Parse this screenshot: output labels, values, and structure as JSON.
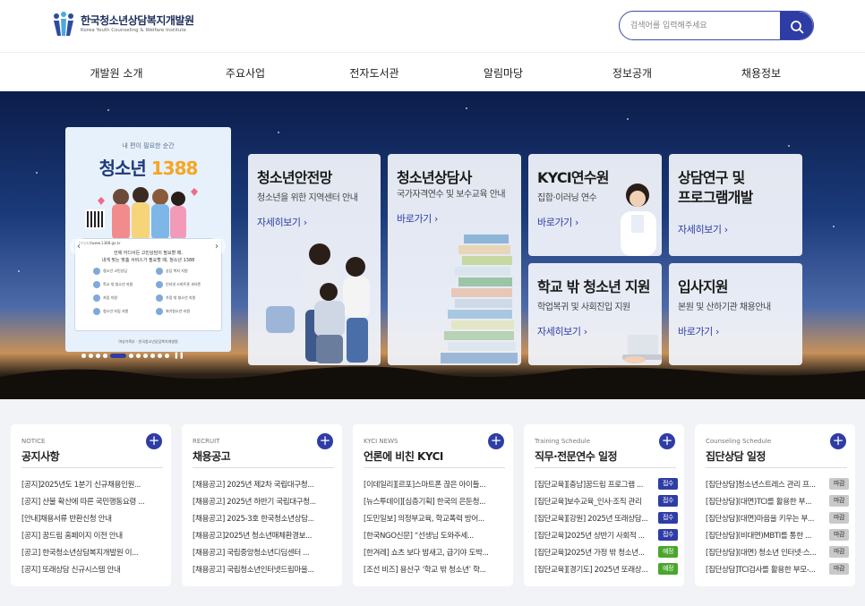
{
  "logo": {
    "name": "한국청소년상담복지개발원",
    "sub": "Korea Youth Counseling & Welfare Institute"
  },
  "search": {
    "placeholder": "검색어를 입력해주세요"
  },
  "nav": [
    "개발원 소개",
    "주요사업",
    "전자도서관",
    "알림마당",
    "정보공개",
    "채용정보"
  ],
  "poster": {
    "top": "내 편이 필요한 순간",
    "title": "청소년",
    "num": "1388",
    "url": "https://www.1388.go.kr",
    "head1": "언제 어디서든 고민상담이 필요할 때,",
    "head2": "내게 맞는 맞춤 서비스가 필요할 때, 청소년 1388",
    "grid": [
      "청소년 고민상담",
      "상담 복지 지원",
      "학교 밖 청소년 지원",
      "인터넷 스마트폰 과의존",
      "자립 지원",
      "가정 밖 청소년 지원",
      "청소년 자립 지원",
      "위기청소년 지원"
    ],
    "foot": "여성가족부 · 한국청소년상담복지개발원"
  },
  "cards": [
    {
      "title": "청소년안전망",
      "sub": "청소년을 위한 지역센터 안내",
      "link": "자세히보기"
    },
    {
      "title": "청소년상담사",
      "sub": "국가자격연수 및 보수교육 안내",
      "link": "바로가기"
    },
    {
      "title": "KYCI연수원",
      "sub": "집합·이러닝 연수",
      "link": "바로가기"
    },
    {
      "title1": "상담연구 및",
      "title2": "프로그램개발",
      "link": "자세히보기"
    },
    {
      "title": "학교 밖 청소년 지원",
      "sub": "학업복귀 및 사회진입 지원",
      "link": "자세히보기"
    },
    {
      "title": "입사지원",
      "sub": "본원 및 산하기관 채용안내",
      "link": "바로가기"
    }
  ],
  "panels": [
    {
      "cat": "NOTICE",
      "title": "공지사항",
      "items": [
        {
          "t": "[공지]2025년도 1분기 신규채용인원..."
        },
        {
          "t": "[공지] 산불 확산에 따른 국민행동요령 ..."
        },
        {
          "t": "[안내]채용서류 반환신청 안내"
        },
        {
          "t": "[공지] 꿈드림 홈페이지 이전 안내"
        },
        {
          "t": "[공고] 한국청소년상담복지개발원 이..."
        },
        {
          "t": "[공지] 또래상담 신규시스템 안내"
        }
      ]
    },
    {
      "cat": "RECRUIT",
      "title": "채용공고",
      "items": [
        {
          "t": "[채용공고] 2025년 제2차 국립대구청..."
        },
        {
          "t": "[채용공고] 2025년 하반기 국립대구청..."
        },
        {
          "t": "[채용공고] 2025-3호 한국청소년상담..."
        },
        {
          "t": "[채용공고]2025년 청소년매체환경보..."
        },
        {
          "t": "[채용공고] 국립중앙청소년디딤센터 ..."
        },
        {
          "t": "[채용공고] 국립청소년인터넷드림마을..."
        }
      ]
    },
    {
      "cat": "KYCI NEWS",
      "title": "언론에 비친 KYCI",
      "items": [
        {
          "t": "[이데일리][르포]스마트폰 끊은 아이들..."
        },
        {
          "t": "[뉴스투데이][심층기획] 한국의 은둔청..."
        },
        {
          "t": "[도민일보] 의정부교육, 학교폭력 방어..."
        },
        {
          "t": "[한국NGO신문] “선생님 도와주세..."
        },
        {
          "t": "[한겨레] 쇼츠 보다 밤새고, 급기야 도박..."
        },
        {
          "t": "[조선 비즈] 용산구 ‘학교 밖 청소년’ 학..."
        }
      ]
    },
    {
      "cat": "Training Schedule",
      "title": "직무·전문연수 일정",
      "items": [
        {
          "t": "[집단교육][충남]꿈드림 프로그램 ...",
          "b": "접수",
          "c": "b-blue"
        },
        {
          "t": "[집단교육]보수교육_인사·조직 관리",
          "b": "접수",
          "c": "b-blue"
        },
        {
          "t": "[집단교육][강원] 2025년 또래상담...",
          "b": "접수",
          "c": "b-blue"
        },
        {
          "t": "[집단교육]2025년 상반기 사회적 ...",
          "b": "접수",
          "c": "b-blue"
        },
        {
          "t": "[집단교육]2025년 가정 밖 청소년...",
          "b": "예정",
          "c": "b-green"
        },
        {
          "t": "[집단교육][경기도] 2025년 또래상...",
          "b": "예정",
          "c": "b-green"
        }
      ]
    },
    {
      "cat": "Counseling Schedule",
      "title": "집단상담 일정",
      "items": [
        {
          "t": "[집단상담]청소년스트레스 관리 프...",
          "b": "마감",
          "c": "b-gray"
        },
        {
          "t": "[집단상담](대면)TCI를 활용한 부...",
          "b": "마감",
          "c": "b-gray"
        },
        {
          "t": "[집단상담](대면)마음을 키우는 부...",
          "b": "마감",
          "c": "b-gray"
        },
        {
          "t": "[집단상담](비대면)MBTI를 통한 ...",
          "b": "마감",
          "c": "b-gray"
        },
        {
          "t": "[집단상담](대면) 청소년 인터넷·스...",
          "b": "마감",
          "c": "b-gray"
        },
        {
          "t": "[집단상담]TCI검사를 활용한 부모-...",
          "b": "마감",
          "c": "b-gray"
        }
      ]
    }
  ]
}
